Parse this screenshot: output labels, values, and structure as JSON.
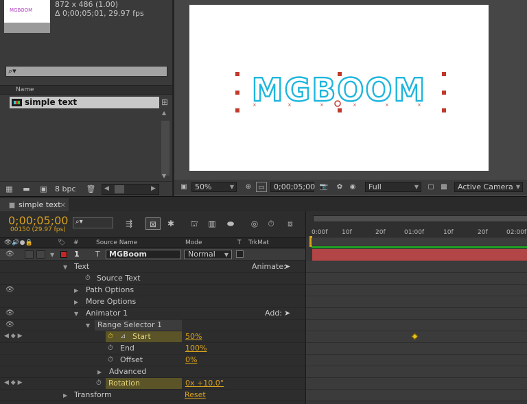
{
  "project": {
    "thumb_text": "MGBOOM",
    "meta_line1": "872 x 486 (1.00)",
    "meta_line2": "Δ 0;00;05;01, 29.97 fps",
    "search_placeholder": "",
    "column_name": "Name",
    "item_label": "simple text",
    "bpc_label": "8 bpc"
  },
  "viewer": {
    "text_content": "MGBOOM",
    "text_color": "#1fb6dd",
    "zoom": "50%",
    "timecode": "0;00;05;00",
    "resolution": "Full",
    "camera": "Active Camera"
  },
  "timeline": {
    "tab_name": "simple text",
    "timecode": "0;00;05;00",
    "frames": "00150 (29.97 fps)",
    "columns": {
      "num": "#",
      "source": "Source Name",
      "mode": "Mode",
      "t": "T",
      "trkmat": "TrkMat"
    },
    "layer": {
      "number": "1",
      "name": "MGBoom",
      "mode": "Normal"
    },
    "props": {
      "text": "Text",
      "animate": "Animate:",
      "source_text": "Source Text",
      "path_options": "Path Options",
      "more_options": "More Options",
      "animator": "Animator 1",
      "add": "Add:",
      "range_selector": "Range Selector 1",
      "start": "Start",
      "start_val": "50%",
      "end": "End",
      "end_val": "100%",
      "offset": "Offset",
      "offset_val": "0%",
      "advanced": "Advanced",
      "rotation": "Rotation",
      "rotation_val": "0x +10.0°",
      "transform": "Transform",
      "reset": "Reset"
    },
    "ruler_ticks": [
      "0:00f",
      "10f",
      "20f",
      "01:00f",
      "10f",
      "20f",
      "02:00f"
    ],
    "colors": {
      "accent": "#d9a21c",
      "layer_bar": "#b24545",
      "work_area": "#20a020",
      "label_red": "#c02828"
    }
  }
}
